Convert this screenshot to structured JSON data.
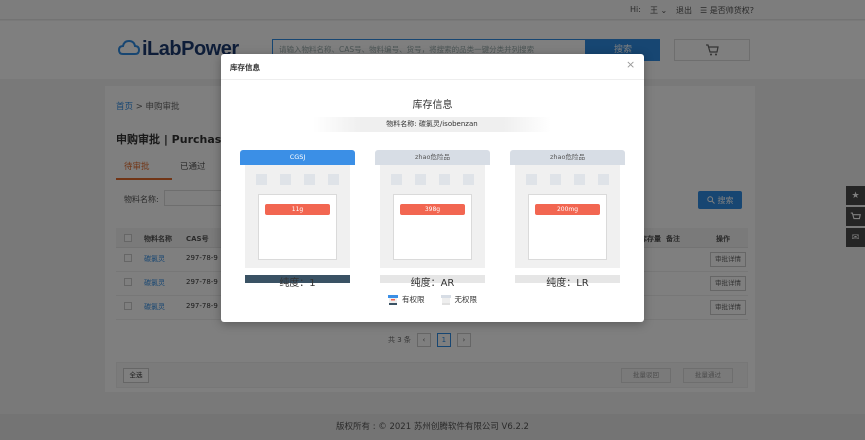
{
  "topbar": {
    "greeting": "Hi:",
    "user": "王",
    "logout": "退出",
    "favorites": "是否帅货权?"
  },
  "header": {
    "logo_text": "iLabPower",
    "search_placeholder": "请输入物料名称、CAS号、物料编号、货号，将搜索的品类一键分类并列搜索",
    "search_label": "搜索"
  },
  "breadcrumb": {
    "home": "首页",
    "separator": ">",
    "current": "申购审批"
  },
  "page_title": "申购审批  |  Purchase",
  "tabs": [
    {
      "label": "待审批"
    },
    {
      "label": "已通过"
    }
  ],
  "filter": {
    "label": "物料名称:",
    "search_label": "搜索"
  },
  "table": {
    "headers": {
      "name": "物料名称",
      "cas": "CAS号",
      "stock": "库存量",
      "note": "备注",
      "action": "操作"
    },
    "rows": [
      {
        "name": "碳氯灵",
        "cas": "297-78-9",
        "action": "审批详情"
      },
      {
        "name": "碳氯灵",
        "cas": "297-78-9",
        "action": "审批详情"
      },
      {
        "name": "碳氯灵",
        "cas": "297-78-9",
        "action": "审批详情"
      }
    ]
  },
  "pager": {
    "total": "共 3 条",
    "prev": "‹",
    "page": "1",
    "next": "›"
  },
  "bottom_bar": {
    "select_all": "全选",
    "batch_reject": "批量驳回",
    "batch_approve": "批量通过"
  },
  "footer": "版权所有 : © 2021 苏州创腾软件有限公司 V6.2.2",
  "modal": {
    "title": "库存信息",
    "close": "×",
    "heading": "库存信息",
    "material_label": "物料名称: 碳氯灵/isobenzan",
    "warehouses": [
      {
        "name": "CGSJ",
        "qty": "11g",
        "purity": "纯度：1",
        "has_permission": true,
        "roof_color": "#3b8fe6",
        "base_color": "#3a5264"
      },
      {
        "name": "zhao危险品",
        "qty": "398g",
        "purity": "纯度：AR",
        "has_permission": false,
        "roof_color": "#d7dde5",
        "base_color": "#e6e6e6"
      },
      {
        "name": "zhao危险品",
        "qty": "200mg",
        "purity": "纯度：LR",
        "has_permission": false,
        "roof_color": "#d7dde5",
        "base_color": "#e6e6e6"
      }
    ],
    "legend": {
      "with_permission": "有权限",
      "without_permission": "无权限"
    }
  }
}
